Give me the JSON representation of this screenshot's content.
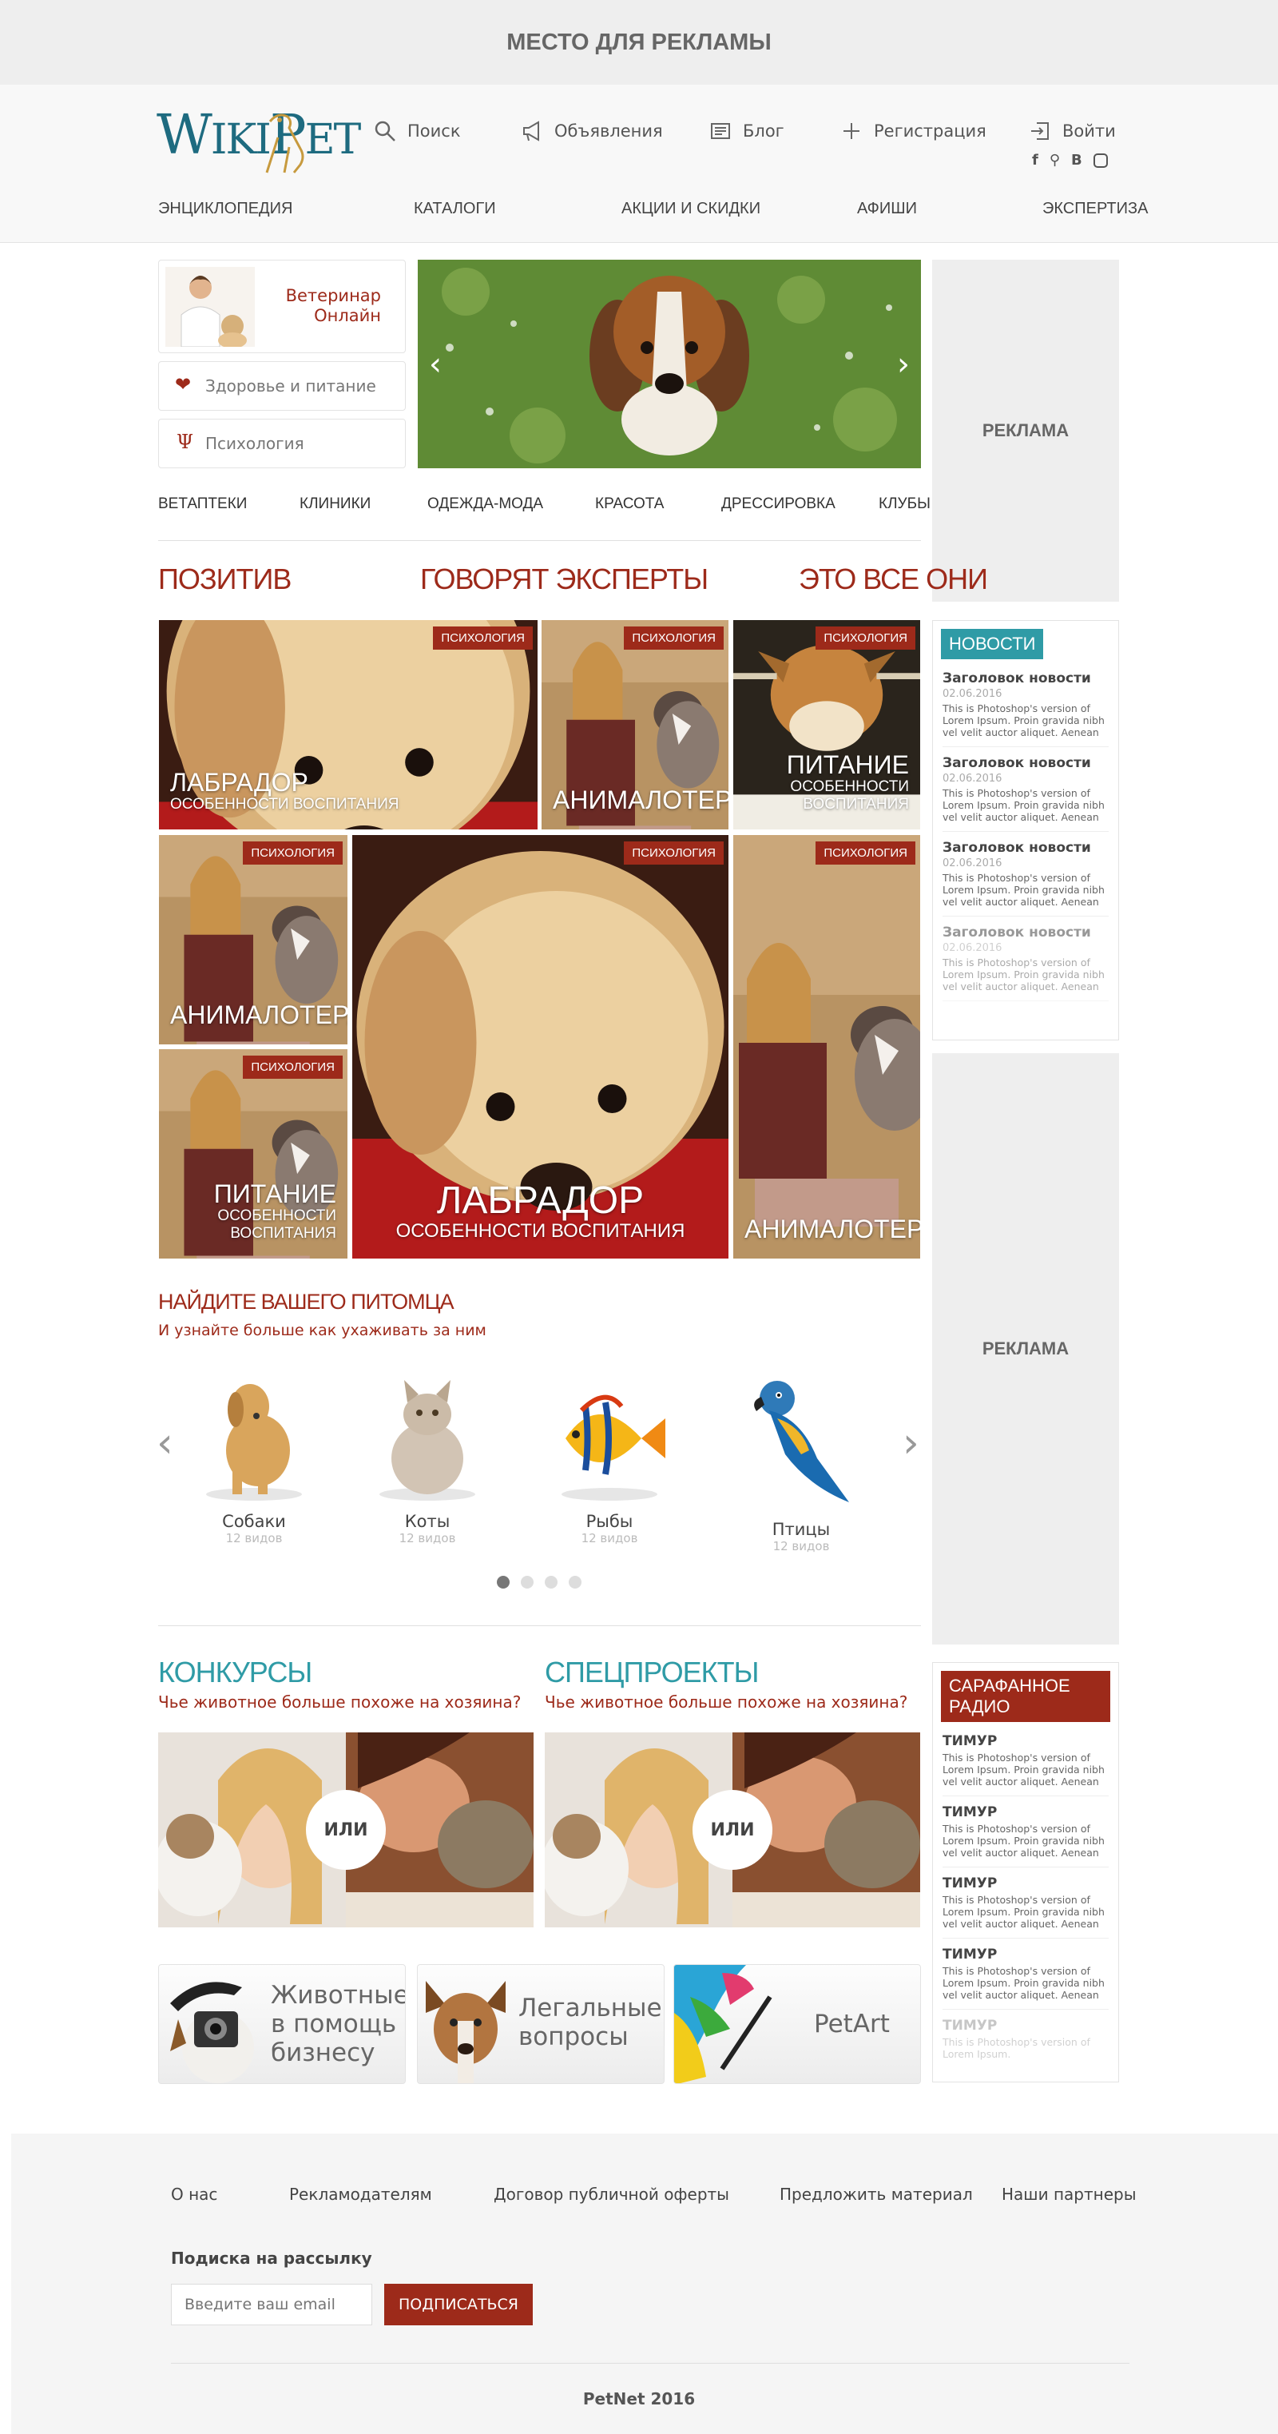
{
  "top_ad": "МЕСТО ДЛЯ РЕКЛАМЫ",
  "logo": "WikiPet",
  "top_nav": [
    {
      "label": "Поиск",
      "icon": "search-icon"
    },
    {
      "label": "Объявления",
      "icon": "megaphone-icon"
    },
    {
      "label": "Блог",
      "icon": "newspaper-icon"
    },
    {
      "label": "Регистрация",
      "icon": "plus-icon"
    },
    {
      "label": "Войти",
      "icon": "login-icon"
    }
  ],
  "social": [
    "f",
    "ok",
    "B",
    "instagram"
  ],
  "main_nav": [
    "ЭНЦИКЛОПЕДИЯ",
    "КАТАЛОГИ",
    "АКЦИИ И СКИДКИ",
    "АФИШИ",
    "ЭКСПЕРТИЗА"
  ],
  "vet": {
    "line1": "Ветеринар",
    "line2": "Онлайн"
  },
  "health_label": "Здоровье и питание",
  "psych_label": "Психология",
  "ad_label": "РЕКЛАМА",
  "categories": [
    "ВЕТАПТЕКИ",
    "КЛИНИКИ",
    "ОДЕЖДА-МОДА",
    "КРАСОТА",
    "ДРЕССИРОВКА",
    "КЛУБЫ"
  ],
  "sections": {
    "pozitiv": "ПОЗИТИВ",
    "experts": "ГОВОРЯТ ЭКСПЕРТЫ",
    "all": "ЭТО ВСЕ ОНИ"
  },
  "badge": "ПСИХОЛОГИЯ",
  "tiles": {
    "labrador": "ЛАБРАДОР",
    "labrador_sub": "ОСОБЕННОСТИ ВОСПИТАНИЯ",
    "animal": "АНИМАЛОТЕРАПИЯ",
    "pitanie": "ПИТАНИЕ",
    "pitanie_sub": "ОСОБЕННОСТИ ВОСПИТАНИЯ"
  },
  "news": {
    "label": "НОВОСТИ",
    "items": [
      {
        "title": "Заголовок новости",
        "date": "02.06.2016",
        "text": "This is Photoshop's version  of Lorem Ipsum. Proin gravida nibh vel velit auctor aliquet. Aenean"
      },
      {
        "title": "Заголовок новости",
        "date": "02.06.2016",
        "text": "This is Photoshop's version  of Lorem Ipsum. Proin gravida nibh vel velit auctor aliquet. Aenean"
      },
      {
        "title": "Заголовок новости",
        "date": "02.06.2016",
        "text": "This is Photoshop's version  of Lorem Ipsum. Proin gravida nibh vel velit auctor aliquet. Aenean"
      },
      {
        "title": "Заголовок новости",
        "date": "02.06.2016",
        "text": "This is Photoshop's version  of Lorem Ipsum. Proin gravida nibh vel velit auctor aliquet. Aenean"
      }
    ]
  },
  "find_pet": {
    "title": "НАЙДИТЕ ВАШЕГО ПИТОМЦА",
    "subtitle": "И узнайте больше как ухаживать за ним"
  },
  "pets": [
    {
      "name": "Собаки",
      "count": "12 видов"
    },
    {
      "name": "Коты",
      "count": "12 видов"
    },
    {
      "name": "Рыбы",
      "count": "12 видов"
    },
    {
      "name": "Птицы",
      "count": "12 видов"
    }
  ],
  "contests": {
    "title": "КОНКУРСЫ",
    "subtitle": "Чье животное больше похоже на хозяина?"
  },
  "special": {
    "title": "СПЕЦПРОЕКТЫ",
    "subtitle": "Чье животное больше похоже на хозяина?"
  },
  "or_label": "ИЛИ",
  "radio": {
    "label": "САРАФАННОЕ РАДИО",
    "items": [
      {
        "name": "ТИМУР",
        "text": "This is Photoshop's version  of Lorem Ipsum. Proin gravida nibh vel velit auctor aliquet. Aenean"
      },
      {
        "name": "ТИМУР",
        "text": "This is Photoshop's version  of Lorem Ipsum. Proin gravida nibh vel velit auctor aliquet. Aenean"
      },
      {
        "name": "ТИМУР",
        "text": "This is Photoshop's version  of Lorem Ipsum. Proin gravida nibh vel velit auctor aliquet. Aenean"
      },
      {
        "name": "ТИМУР",
        "text": "This is Photoshop's version  of Lorem Ipsum. Proin gravida nibh vel velit auctor aliquet. Aenean"
      },
      {
        "name": "ТИМУР",
        "text": "This is Photoshop's version  of Lorem Ipsum."
      }
    ]
  },
  "promos": {
    "business": [
      "Животные",
      "в помощь",
      "бизнесу"
    ],
    "legal": [
      "Легальные",
      "вопросы"
    ],
    "art": "PetArt"
  },
  "footer": {
    "links": [
      "О нас",
      "Рекламодателям",
      "Договор публичной оферты",
      "Предложить материал",
      "Наши партнеры"
    ],
    "subscribe_title": "Подиска на рассылку",
    "email_placeholder": "Введите ваш email",
    "subscribe_button": "ПОДПИСАТЬСЯ",
    "copyright": "PetNet 2016"
  },
  "colors": {
    "accent_red": "#9d2a1a",
    "accent_teal": "#2f9ba6",
    "logo": "#1e6b80"
  }
}
